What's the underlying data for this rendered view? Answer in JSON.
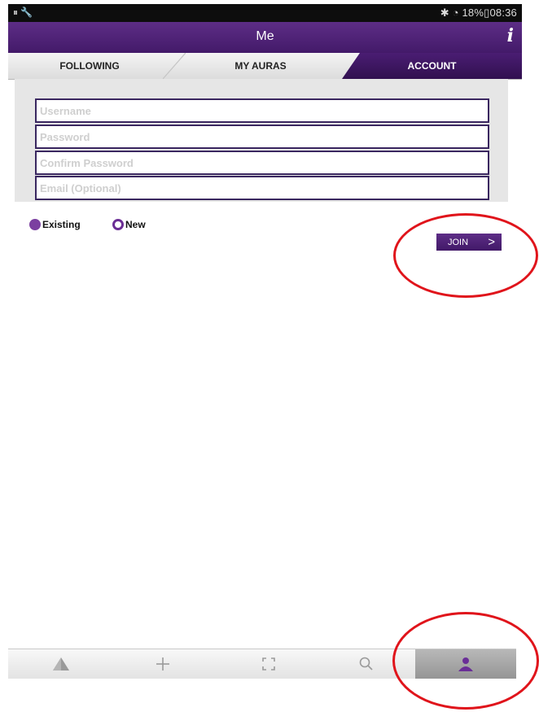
{
  "status_bar": {
    "left_icons": "⏸︎ 🔧",
    "right_text": "✱ ◔ 18%▯08:36"
  },
  "title_bar": {
    "title": "Me",
    "info_icon_text": "i"
  },
  "tabs": [
    {
      "label": "FOLLOWING"
    },
    {
      "label": "MY AURAS"
    },
    {
      "label": "ACCOUNT",
      "selected": true
    }
  ],
  "form": {
    "username_placeholder": "Username",
    "password_placeholder": "Password",
    "confirm_password_placeholder": "Confirm Password",
    "email_placeholder": "Email (Optional)"
  },
  "account_mode": {
    "existing_label": "Existing",
    "new_label": "New",
    "selected": "existing"
  },
  "join_button": {
    "label": "JOIN",
    "chevron": ">"
  },
  "bottom_nav": {
    "items": [
      "auras-icon",
      "add-icon",
      "scan-icon",
      "search-icon",
      "profile-icon"
    ],
    "active": "profile-icon"
  },
  "colors": {
    "brand_purple": "#4a1d73",
    "accent_purple": "#7b3fa0",
    "annotation_red": "#e0141b"
  }
}
